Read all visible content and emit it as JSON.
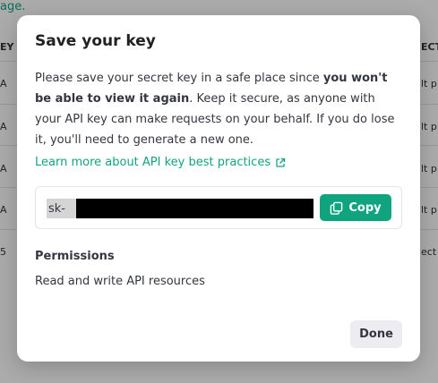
{
  "background": {
    "link_text": "age.",
    "header_left": "EY",
    "header_right": "ECT",
    "rows": [
      {
        "left": "A",
        "right": "lt p"
      },
      {
        "left": "A",
        "right": "lt p"
      },
      {
        "left": "A",
        "right": "lt p"
      },
      {
        "left": "A",
        "right": "lt p"
      },
      {
        "left": "5",
        "right": "ect"
      }
    ]
  },
  "modal": {
    "title": "Save your key",
    "description": {
      "part1": "Please save your secret key in a safe place since ",
      "bold": "you won't be able to view it again",
      "part2": ". Keep it secure, as anyone with your API key can make requests on your behalf. If you do lose it, you'll need to generate a new one."
    },
    "learn_link": "Learn more about API key best practices",
    "key_prefix": "sk-",
    "copy_label": "Copy",
    "permissions_label": "Permissions",
    "permissions_value": "Read and write API resources",
    "done_label": "Done"
  },
  "colors": {
    "accent": "#10a37f",
    "overlay": "rgba(0,0,0,0.33)"
  }
}
